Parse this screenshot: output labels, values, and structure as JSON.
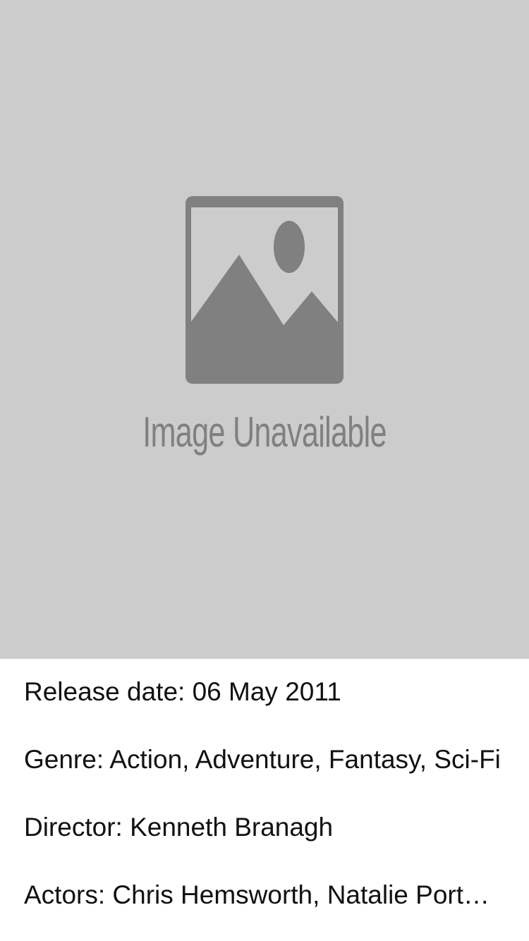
{
  "poster": {
    "icon": "image-placeholder-icon",
    "placeholder_text": "Image Unavailable",
    "background_color": "#cccccc",
    "icon_color": "#808080"
  },
  "details": {
    "release": "Release date: 06 May 2011",
    "genre": "Genre: Action, Adventure, Fantasy, Sci-Fi",
    "director": "Director: Kenneth Branagh",
    "actors": "Actors: Chris Hemsworth, Natalie Portman"
  }
}
